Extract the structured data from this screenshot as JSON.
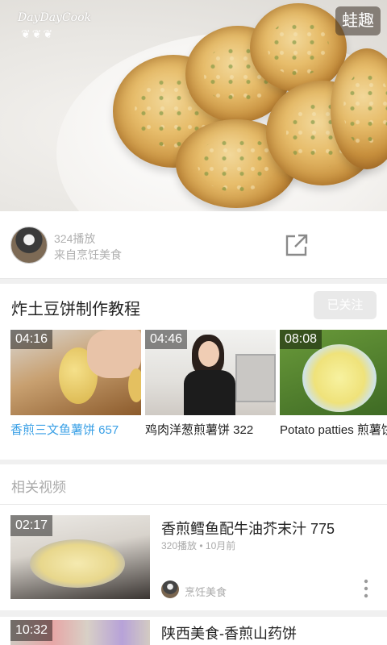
{
  "hero": {
    "logo_text": "DayDayCook",
    "logo_leaves": "❦❦❦",
    "badge": "蛙趣"
  },
  "author": {
    "plays": "324播放",
    "from": "来自烹饪美食"
  },
  "series": {
    "title": "炸土豆饼制作教程",
    "follow_label": "已关注",
    "videos": [
      {
        "duration": "04:16",
        "caption": "香煎三文鱼薯饼 657",
        "caption_color": "#3aa0e6"
      },
      {
        "duration": "04:46",
        "caption": "鸡肉洋葱煎薯饼 322",
        "caption_color": "#222222"
      },
      {
        "duration": "08:08",
        "caption": "Potato patties 煎薯饼",
        "caption_color": "#222222"
      }
    ]
  },
  "related": {
    "label": "相关视频",
    "items": [
      {
        "duration": "02:17",
        "title": "香煎鳕鱼配牛油芥末汁 775",
        "meta": "320播放 • 10月前",
        "source": "烹饪美食"
      },
      {
        "duration": "10:32",
        "title": "陕西美食-香煎山药饼"
      }
    ]
  },
  "colors": {
    "accent_blue": "#3aa0e6",
    "divider": "#e6e6e6",
    "muted_text": "#aaaaaa"
  }
}
